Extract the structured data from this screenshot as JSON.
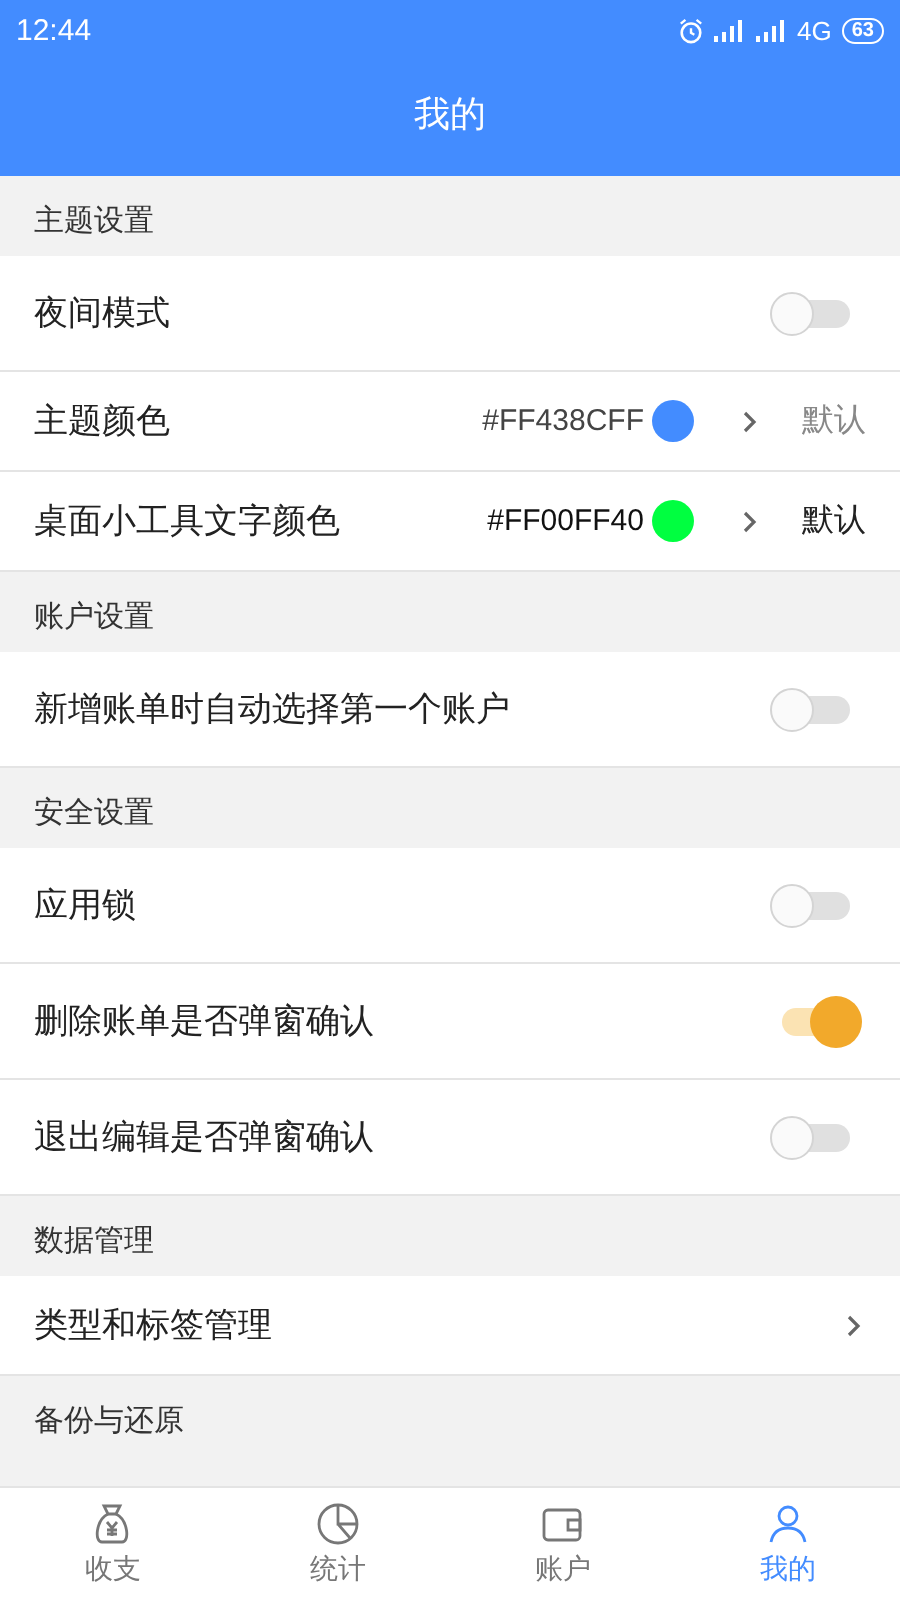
{
  "status_bar": {
    "time": "12:44",
    "network": "4G",
    "battery": "63"
  },
  "title": "我的",
  "sections": [
    {
      "title": "主题设置",
      "items": [
        {
          "kind": "toggle",
          "label": "夜间模式",
          "on": false
        },
        {
          "kind": "color",
          "label": "主题颜色",
          "value": "#FF438CFF",
          "color": "#438cff",
          "action": "默认",
          "dim": true
        },
        {
          "kind": "color",
          "label": "桌面小工具文字颜色",
          "value": "#FF00FF40",
          "color": "#00ff40",
          "action": "默认",
          "dim": false
        }
      ]
    },
    {
      "title": "账户设置",
      "items": [
        {
          "kind": "toggle",
          "label": "新增账单时自动选择第一个账户",
          "on": false
        }
      ]
    },
    {
      "title": "安全设置",
      "items": [
        {
          "kind": "toggle",
          "label": "应用锁",
          "on": false
        },
        {
          "kind": "toggle",
          "label": "删除账单是否弹窗确认",
          "on": true
        },
        {
          "kind": "toggle",
          "label": "退出编辑是否弹窗确认",
          "on": false
        }
      ]
    },
    {
      "title": "数据管理",
      "items": [
        {
          "kind": "link",
          "label": "类型和标签管理"
        }
      ]
    },
    {
      "title": "备份与还原"
    }
  ],
  "tabs": [
    {
      "kind": "income",
      "label": "收支",
      "selected": false
    },
    {
      "kind": "stats",
      "label": "统计",
      "selected": false
    },
    {
      "kind": "accounts",
      "label": "账户",
      "selected": false
    },
    {
      "kind": "profile",
      "label": "我的",
      "selected": true
    }
  ]
}
